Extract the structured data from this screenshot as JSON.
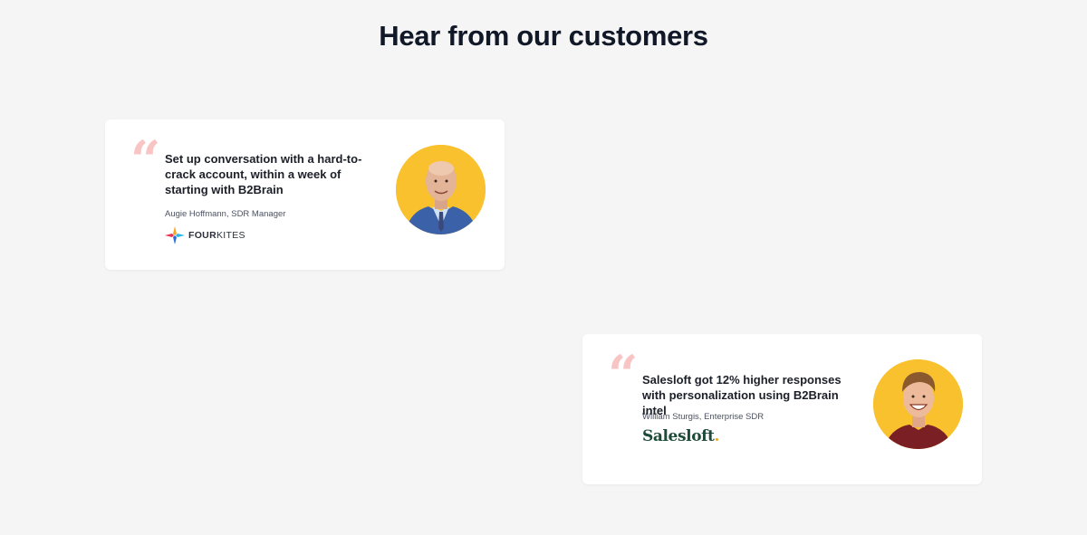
{
  "header": {
    "title": "Hear from our customers"
  },
  "colors": {
    "background": "#f5f5f5",
    "card": "#ffffff",
    "quote_mark": "#f8c4c4",
    "avatar_bg": "#f8c12d",
    "salesloft_green": "#1d4b3a"
  },
  "testimonials": [
    {
      "quote_mark": "“",
      "quote": "Set up conversation with a hard-to-crack account, within a week of starting with B2Brain",
      "author": "Augie Hoffmann, SDR Manager",
      "logo": {
        "icon": "fourkites-logo-icon",
        "text_bold": "FOUR",
        "text_light": "KITES"
      },
      "avatar": "augie-hoffmann-avatar"
    },
    {
      "quote_mark": "“",
      "quote": "Salesloft got 12% higher responses with personalization using B2Brain intel",
      "author": "William Sturgis, Enterprise SDR",
      "logo": {
        "icon": "salesloft-logo",
        "text": "Salesloft",
        "dot": "."
      },
      "avatar": "william-sturgis-avatar"
    }
  ]
}
